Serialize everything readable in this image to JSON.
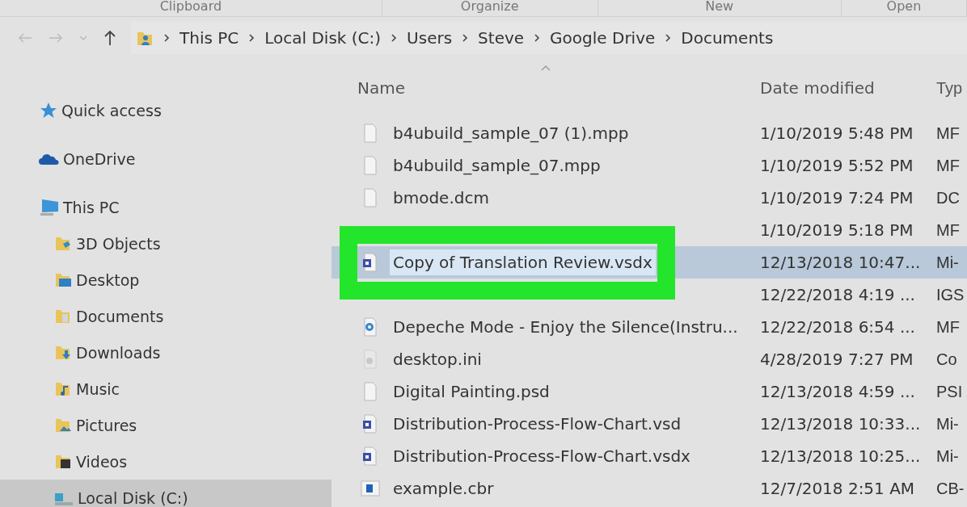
{
  "ribbon_groups": [
    "Clipboard",
    "Organize",
    "New",
    "Open"
  ],
  "address_bar": {
    "path": [
      "This PC",
      "Local Disk (C:)",
      "Users",
      "Steve",
      "Google Drive",
      "Documents"
    ]
  },
  "navigation_pane": {
    "items": [
      {
        "label": "Quick access",
        "kind": "star",
        "selected": false
      },
      {
        "label": "OneDrive",
        "kind": "cloud",
        "selected": false
      },
      {
        "label": "This PC",
        "kind": "pc",
        "selected": false,
        "children": [
          {
            "label": "3D Objects",
            "kind": "objects",
            "selected": false
          },
          {
            "label": "Desktop",
            "kind": "desktop",
            "selected": false
          },
          {
            "label": "Documents",
            "kind": "documents",
            "selected": false
          },
          {
            "label": "Downloads",
            "kind": "downloads",
            "selected": false
          },
          {
            "label": "Music",
            "kind": "music",
            "selected": false
          },
          {
            "label": "Pictures",
            "kind": "pictures",
            "selected": false
          },
          {
            "label": "Videos",
            "kind": "videos",
            "selected": false
          },
          {
            "label": "Local Disk (C:)",
            "kind": "drive",
            "selected": true
          }
        ]
      }
    ]
  },
  "file_list": {
    "columns": [
      "Name",
      "Date modified",
      "Typ"
    ],
    "rows": [
      {
        "kind": "file",
        "name": "b4ubuild_sample_07 (1).mpp",
        "date": "1/10/2019 5:48 PM",
        "type": "MF",
        "selected": false,
        "highlighted": false
      },
      {
        "kind": "file",
        "name": "b4ubuild_sample_07.mpp",
        "date": "1/10/2019 5:52 PM",
        "type": "MF",
        "selected": false,
        "highlighted": false
      },
      {
        "kind": "file",
        "name": "bmode.dcm",
        "date": "1/10/2019 7:24 PM",
        "type": "DC",
        "selected": false,
        "highlighted": false
      },
      {
        "date": "1/10/2019 5:18 PM",
        "type": "MF",
        "selected": false,
        "highlighted": false
      },
      {
        "kind": "visio",
        "name": "Copy of Translation Review.vsdx",
        "date": "12/13/2018 10:47...",
        "type": "Mi-",
        "selected": true,
        "highlighted": true
      },
      {
        "date": "12/22/2018 4:19 ...",
        "type": "IGS",
        "selected": false,
        "highlighted": false
      },
      {
        "kind": "media",
        "name": "Depeche Mode - Enjoy the Silence(Instru...",
        "date": "12/22/2018 6:54 ...",
        "type": "MF",
        "selected": false,
        "highlighted": false
      },
      {
        "kind": "settings",
        "name": "desktop.ini",
        "date": "4/28/2019 7:27 PM",
        "type": "Co",
        "selected": false,
        "highlighted": false
      },
      {
        "kind": "file",
        "name": "Digital Painting.psd",
        "date": "12/13/2018 4:59 ...",
        "type": "PSI",
        "selected": false,
        "highlighted": false
      },
      {
        "kind": "visio",
        "name": "Distribution-Process-Flow-Chart.vsd",
        "date": "12/13/2018 10:33...",
        "type": "Mi-",
        "selected": false,
        "highlighted": false
      },
      {
        "kind": "visio",
        "name": "Distribution-Process-Flow-Chart.vsdx",
        "date": "12/13/2018 10:25...",
        "type": "Mi-",
        "selected": false,
        "highlighted": false
      },
      {
        "kind": "image",
        "name": "example.cbr",
        "date": "12/7/2018 2:51 AM",
        "type": "CB-",
        "selected": false,
        "highlighted": false
      }
    ]
  }
}
